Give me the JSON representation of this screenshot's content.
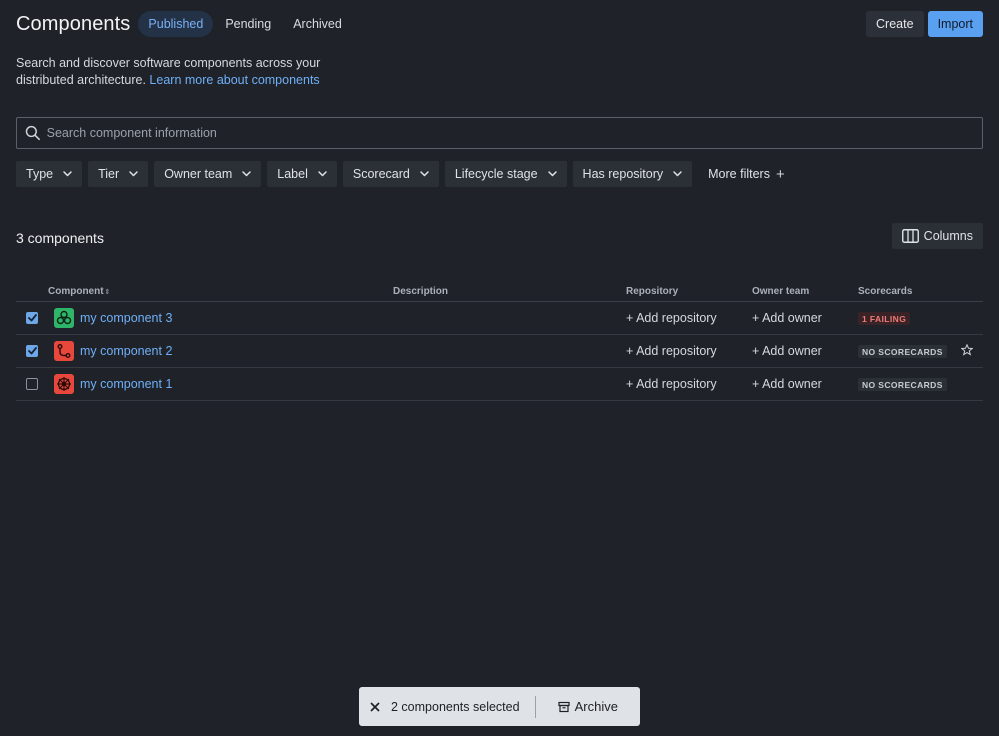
{
  "header": {
    "title": "Components",
    "tabs": [
      "Published",
      "Pending",
      "Archived"
    ],
    "active_tab": "Published",
    "create_label": "Create",
    "import_label": "Import"
  },
  "description": {
    "text": "Search and discover software components across your distributed architecture.",
    "link": "Learn more about components"
  },
  "search": {
    "placeholder": "Search component information"
  },
  "filters": [
    "Type",
    "Tier",
    "Owner team",
    "Label",
    "Scorecard",
    "Lifecycle stage",
    "Has repository"
  ],
  "more_filters_label": "More filters",
  "count_label": "3 components",
  "columns_label": "Columns",
  "table": {
    "headers": {
      "component": "Component",
      "description": "Description",
      "repository": "Repository",
      "owner_team": "Owner team",
      "scorecards": "Scorecards"
    },
    "rows": [
      {
        "name": "my component 3",
        "checked": true,
        "icon": "cluster-icon",
        "icon_color": "#2fb56a",
        "repository": "+ Add repository",
        "owner": "+ Add owner",
        "scorecard": "1 FAILING",
        "scorecard_type": "fail"
      },
      {
        "name": "my component 2",
        "checked": true,
        "icon": "branch-icon",
        "icon_color": "#e8483c",
        "repository": "+ Add repository",
        "owner": "+ Add owner",
        "scorecard": "NO SCORECARDS",
        "scorecard_type": "none",
        "star": true
      },
      {
        "name": "my component 1",
        "checked": false,
        "icon": "helm-icon",
        "icon_color": "#e8483c",
        "repository": "+ Add repository",
        "owner": "+ Add owner",
        "scorecard": "NO SCORECARDS",
        "scorecard_type": "none"
      }
    ]
  },
  "selection_bar": {
    "selected_label": "2 components selected",
    "archive_label": "Archive"
  }
}
